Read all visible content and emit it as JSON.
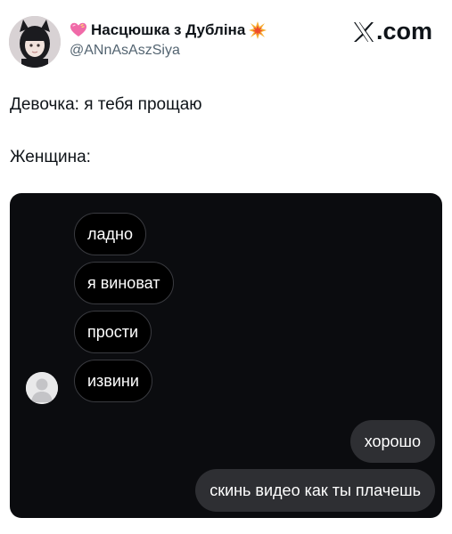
{
  "post": {
    "author_name": "Насцюшка з Дубліна",
    "author_handle": "@ANnAsAszSiya",
    "brand": ".com",
    "lines": [
      "Девочка: я тебя прощаю",
      "Женщина:"
    ]
  },
  "chat": {
    "incoming": [
      "ладно",
      "я виноват",
      "прости",
      "извини"
    ],
    "outgoing": [
      "хорошо",
      "скинь видео как ты плачешь"
    ]
  },
  "icons": {
    "name_prefix": "pink-heart-icon",
    "name_suffix": "collision-icon",
    "brand_logo": "x-logo-icon",
    "chat_avatar": "default-user-avatar-icon"
  },
  "colors": {
    "chat_background": "#0b0c0f",
    "incoming_bubble": "#000000",
    "outgoing_bubble": "#2e2f33",
    "handle_text": "#536471"
  }
}
